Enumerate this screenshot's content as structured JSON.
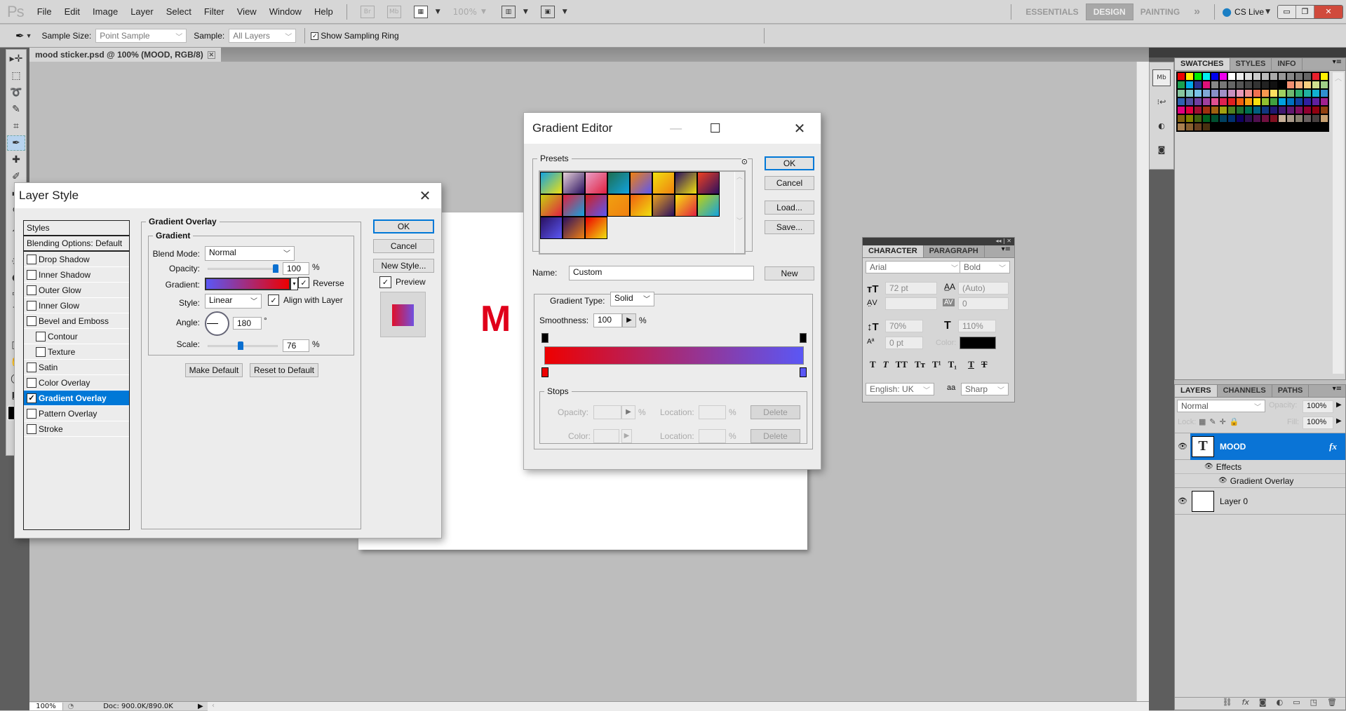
{
  "app": {
    "logo": "Ps",
    "menu": [
      "File",
      "Edit",
      "Image",
      "Layer",
      "Select",
      "Filter",
      "View",
      "Window",
      "Help"
    ],
    "toolbar_icons": {
      "bridge": "Br",
      "minibridge": "Mb",
      "zoom": "100%"
    },
    "workspaces": [
      {
        "label": "ESSENTIALS",
        "active": false
      },
      {
        "label": "DESIGN",
        "active": true
      },
      {
        "label": "PAINTING",
        "active": false
      }
    ],
    "more": "»",
    "cslive": "CS Live",
    "window_buttons": {
      "minimize": "▭",
      "restore": "❐",
      "close": "✕"
    }
  },
  "options_bar": {
    "sample_size_label": "Sample Size:",
    "sample_size_value": "Point Sample",
    "sample_label": "Sample:",
    "sample_value": "All Layers",
    "show_ring_label": "Show Sampling Ring",
    "show_ring_checked": true
  },
  "document": {
    "tab_title": "mood sticker.psd @ 100% (MOOD, RGB/8)",
    "canvas_text": "M",
    "text_color": "#e0001a"
  },
  "status": {
    "zoom": "100%",
    "doc": "Doc: 900.0K/890.0K"
  },
  "layer_style": {
    "title": "Layer Style",
    "styles_header": "Styles",
    "blending_options": "Blending Options: Default",
    "items": [
      {
        "label": "Drop Shadow",
        "checked": false,
        "sub": false,
        "active": false
      },
      {
        "label": "Inner Shadow",
        "checked": false,
        "sub": false,
        "active": false
      },
      {
        "label": "Outer Glow",
        "checked": false,
        "sub": false,
        "active": false
      },
      {
        "label": "Inner Glow",
        "checked": false,
        "sub": false,
        "active": false
      },
      {
        "label": "Bevel and Emboss",
        "checked": false,
        "sub": false,
        "active": false
      },
      {
        "label": "Contour",
        "checked": false,
        "sub": true,
        "active": false
      },
      {
        "label": "Texture",
        "checked": false,
        "sub": true,
        "active": false
      },
      {
        "label": "Satin",
        "checked": false,
        "sub": false,
        "active": false
      },
      {
        "label": "Color Overlay",
        "checked": false,
        "sub": false,
        "active": false
      },
      {
        "label": "Gradient Overlay",
        "checked": true,
        "sub": false,
        "active": true
      },
      {
        "label": "Pattern Overlay",
        "checked": false,
        "sub": false,
        "active": false
      },
      {
        "label": "Stroke",
        "checked": false,
        "sub": false,
        "active": false
      }
    ],
    "section_title": "Gradient Overlay",
    "group_title": "Gradient",
    "blend_mode_label": "Blend Mode:",
    "blend_mode": "Normal",
    "opacity_label": "Opacity:",
    "opacity": "100",
    "opacity_fraction": 1.0,
    "gradient_label": "Gradient:",
    "reverse_label": "Reverse",
    "reverse_checked": true,
    "style_label": "Style:",
    "style": "Linear",
    "align_label": "Align with Layer",
    "align_checked": true,
    "angle_label": "Angle:",
    "angle": "180",
    "degree": "°",
    "scale_label": "Scale:",
    "scale": "76",
    "scale_fraction": 0.46,
    "percent": "%",
    "make_default": "Make Default",
    "reset_default": "Reset to Default",
    "ok": "OK",
    "cancel": "Cancel",
    "new_style": "New Style...",
    "preview_label": "Preview",
    "preview_checked": true
  },
  "gradient_editor": {
    "title": "Gradient Editor",
    "presets_label": "Presets",
    "ok": "OK",
    "cancel": "Cancel",
    "load": "Load...",
    "save": "Save...",
    "name_label": "Name:",
    "name_value": "Custom",
    "new": "New",
    "type_label": "Gradient Type:",
    "type_value": "Solid",
    "smoothness_label": "Smoothness:",
    "smoothness": "100",
    "percent": "%",
    "gradient_colors": {
      "start": "#ee0000",
      "end": "#5a57f5"
    },
    "stops_label": "Stops",
    "opacity_label": "Opacity:",
    "color_label": "Color:",
    "location_label": "Location:",
    "delete": "Delete",
    "presets": [
      [
        "#12a3e0",
        "#e6d0d8",
        "#e8a0c8",
        "#1d6e50",
        "#f08010",
        "#f0e010",
        "#2a1060",
        "#f04020"
      ],
      [
        "#c8d010",
        "#e02040",
        "#d02020",
        "#f0a010",
        "#f06010",
        "#e8a020",
        "#f8e010",
        "#c0d010"
      ],
      [
        "#2a1060",
        "#2a1060",
        "#ee0000"
      ]
    ]
  },
  "character": {
    "tabs": [
      "CHARACTER",
      "PARAGRAPH"
    ],
    "font": "Arial",
    "style": "Bold",
    "size": "72 pt",
    "leading": "(Auto)",
    "kerning": "",
    "tracking": "0",
    "vscale": "70%",
    "hscale": "110%",
    "baseline": "0 pt",
    "color_label": "Color:",
    "color": "#000000",
    "type_buttons": [
      "T",
      "T",
      "TT",
      "Tт",
      "T¹",
      "T₁",
      "T",
      "T"
    ],
    "language": "English: UK",
    "aa_icon": "aa",
    "antialias": "Sharp"
  },
  "swatches": {
    "tabs": [
      "SWATCHES",
      "STYLES",
      "INFO"
    ],
    "colors": [
      "#ee0000",
      "#ffee00",
      "#00ee00",
      "#00eeee",
      "#0000ee",
      "#ee00ee",
      "#ffffff",
      "#eeeeee",
      "#dddddd",
      "#cccccc",
      "#bbbbbb",
      "#aaaaaa",
      "#999999",
      "#888888",
      "#777777",
      "#666666",
      "#e8202c",
      "#fff000",
      "#1aa050",
      "#00a8e8",
      "#2a3090",
      "#e0107a",
      "#888888",
      "#777777",
      "#666666",
      "#555555",
      "#444444",
      "#333333",
      "#222222",
      "#111111",
      "#000000",
      "#f49070",
      "#f8b080",
      "#f8d080",
      "#d0e090",
      "#a0d088",
      "#88c8a0",
      "#80c8c8",
      "#78c0e8",
      "#80a8d8",
      "#8890c8",
      "#a090c8",
      "#c890c0",
      "#e898b8",
      "#f09090",
      "#f07050",
      "#f89850",
      "#fce060",
      "#a0d060",
      "#70b870",
      "#30b070",
      "#20b0a0",
      "#10b0d0",
      "#3090d0",
      "#3060b0",
      "#5050a0",
      "#7040a0",
      "#a040a0",
      "#e05090",
      "#e02050",
      "#e02020",
      "#f06010",
      "#f8a010",
      "#f8e010",
      "#90c030",
      "#40a040",
      "#00a0e0",
      "#0070c0",
      "#1040a0",
      "#3020a0",
      "#6020a0",
      "#a02090",
      "#e00080",
      "#e00040",
      "#a01030",
      "#a03010",
      "#a06010",
      "#a0a010",
      "#508020",
      "#207030",
      "#007050",
      "#006080",
      "#103880",
      "#201870",
      "#401870",
      "#601870",
      "#801060",
      "#900030",
      "#900010",
      "#904010",
      "#806010",
      "#808000",
      "#406010",
      "#006020",
      "#005030",
      "#004060",
      "#003070",
      "#100060",
      "#301050",
      "#501050",
      "#701040",
      "#801020",
      "#c8b098",
      "#a89888",
      "#888070",
      "#686060",
      "#484040",
      "#c8a070",
      "#a88050",
      "#886030",
      "#684020",
      "#483010"
    ]
  },
  "layers": {
    "tabs": [
      "LAYERS",
      "CHANNELS",
      "PATHS"
    ],
    "blend_mode": "Normal",
    "opacity_label": "Opacity:",
    "opacity": "100%",
    "lock_label": "Lock:",
    "fill_label": "Fill:",
    "fill": "100%",
    "items": [
      {
        "name": "MOOD",
        "thumb": "T",
        "selected": true,
        "fx": "fx"
      },
      {
        "name": "Effects",
        "effect": true
      },
      {
        "name": "Gradient Overlay",
        "effect": true,
        "sub": true
      },
      {
        "name": "Layer 0",
        "thumb": "",
        "selected": false
      }
    ]
  }
}
